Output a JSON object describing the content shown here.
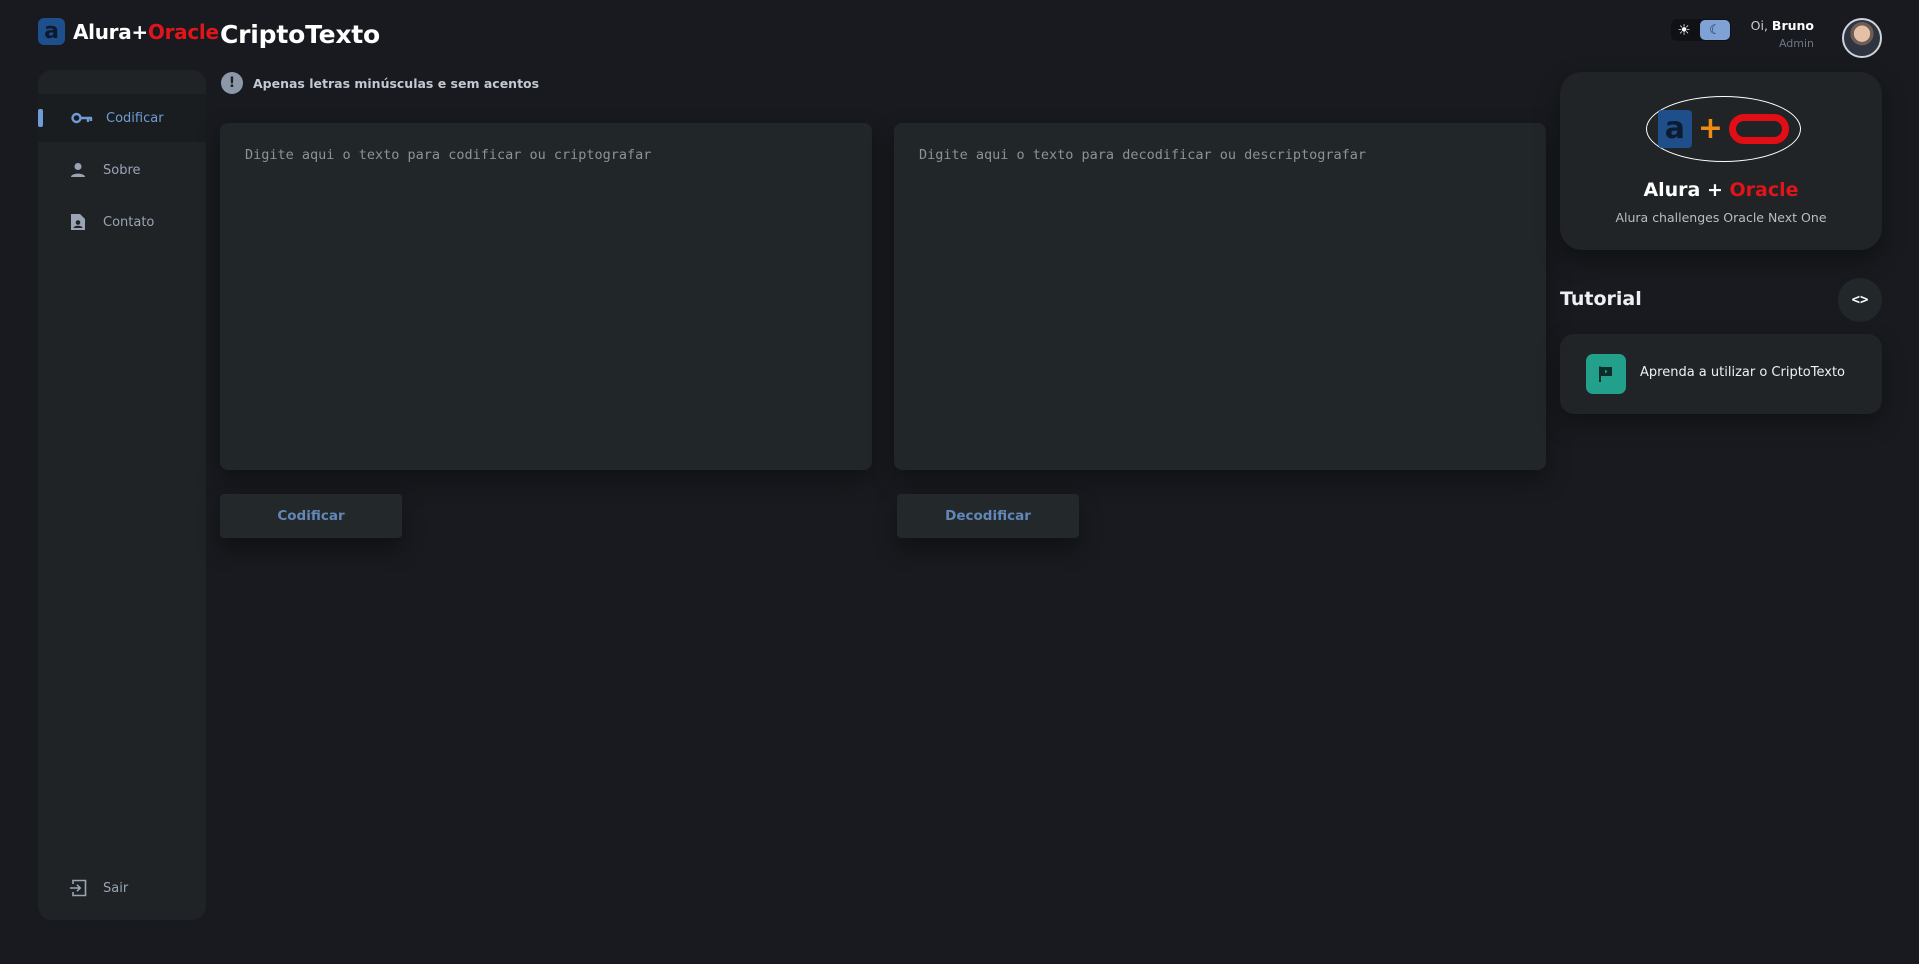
{
  "brand": {
    "part1": "Alura+",
    "part2": "Oracle",
    "logo_letter": "a"
  },
  "sidebar": {
    "items": [
      {
        "label": "Codificar",
        "icon": "key-icon",
        "active": true
      },
      {
        "label": "Sobre",
        "icon": "person-icon",
        "active": false
      },
      {
        "label": "Contato",
        "icon": "contact-card-icon",
        "active": false
      }
    ],
    "logout": {
      "label": "Sair",
      "icon": "logout-icon"
    }
  },
  "page": {
    "title": "CriptoTexto",
    "hint": "Apenas letras minúsculas e sem acentos"
  },
  "editor": {
    "encode_placeholder": "Digite aqui o texto para codificar ou criptografar",
    "decode_placeholder": "Digite aqui o texto para decodificar ou descriptografar",
    "encode_button": "Codificar",
    "decode_button": "Decodificar"
  },
  "user": {
    "greeting": "Oi,",
    "name": "Bruno",
    "role": "Admin"
  },
  "promo": {
    "title_part1": "Alura + ",
    "title_part2": "Oracle",
    "subtitle": "Alura challenges Oracle Next One"
  },
  "tutorial": {
    "title": "Tutorial",
    "item_label": "Aprenda a utilizar o CriptoTexto"
  },
  "colors": {
    "background": "#181a1f",
    "panel": "#212628",
    "accent_blue": "#6f9bd6",
    "brand_red": "#e0141b",
    "tutorial_icon": "#22a08c"
  }
}
